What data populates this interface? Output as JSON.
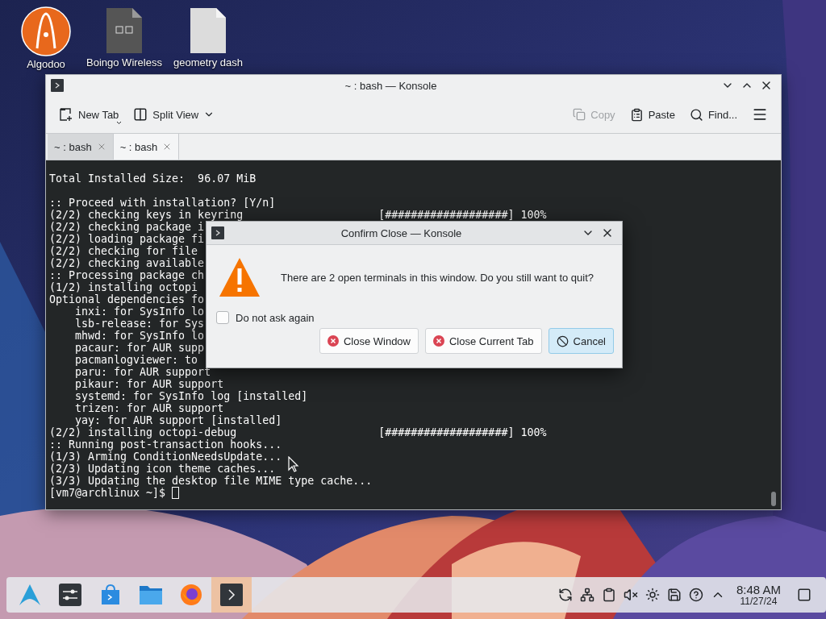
{
  "desktop": {
    "icons": [
      {
        "label": "Algodoo",
        "kind": "app"
      },
      {
        "label": "Boingo Wireless",
        "kind": "dark-file"
      },
      {
        "label": "geometry dash",
        "kind": "file"
      }
    ]
  },
  "window": {
    "title": "~ : bash — Konsole",
    "toolbar": [
      {
        "label": "New Tab",
        "kind": "new-tab",
        "disabled": false
      },
      {
        "label": "Split View",
        "kind": "split",
        "disabled": false
      },
      {
        "label": "Copy",
        "kind": "copy",
        "disabled": true
      },
      {
        "label": "Paste",
        "kind": "paste",
        "disabled": false
      },
      {
        "label": "Find...",
        "kind": "find",
        "disabled": false
      }
    ],
    "tabs": [
      {
        "label": "~ : bash",
        "selected": false
      },
      {
        "label": "~ : bash",
        "selected": true
      }
    ],
    "terminal": {
      "lines": [
        {
          "text": "Total Installed Size:  96.07 MiB",
          "blank_before": true
        },
        {
          "text": ":: Proceed with installation? [Y/n]",
          "blank_before": true
        },
        {
          "text": "(2/2) checking keys in keyring",
          "progress": "[###################] 100%"
        },
        {
          "text": "(2/2) checking package i"
        },
        {
          "text": "(2/2) loading package fi"
        },
        {
          "text": "(2/2) checking for file"
        },
        {
          "text": "(2/2) checking available"
        },
        {
          "text": ":: Processing package ch"
        },
        {
          "text": "(1/2) installing octopi"
        },
        {
          "text": "Optional dependencies fo"
        },
        {
          "text": "    inxi: for SysInfo lo"
        },
        {
          "text": "    lsb-release: for Sys"
        },
        {
          "text": "    mhwd: for SysInfo lo"
        },
        {
          "text": "    pacaur: for AUR supp"
        },
        {
          "text": "    pacmanlogviewer: to"
        },
        {
          "text": "    paru: for AUR support"
        },
        {
          "text": "    pikaur: for AUR support"
        },
        {
          "text": "    systemd: for SysInfo log [installed]"
        },
        {
          "text": "    trizen: for AUR support"
        },
        {
          "text": "    yay: for AUR support [installed]"
        },
        {
          "text": "(2/2) installing octopi-debug",
          "progress": "[###################] 100%"
        },
        {
          "text": ":: Running post-transaction hooks..."
        },
        {
          "text": "(1/3) Arming ConditionNeedsUpdate..."
        },
        {
          "text": "(2/3) Updating icon theme caches..."
        },
        {
          "text": "(3/3) Updating the desktop file MIME type cache..."
        },
        {
          "text": "[vm7@archlinux ~]$ ",
          "cursor": true
        }
      ]
    }
  },
  "dialog": {
    "title": "Confirm Close — Konsole",
    "message": "There are 2 open terminals in this window. Do you still want to quit?",
    "checkbox": {
      "label": "Do not ask again",
      "checked": false
    },
    "buttons": [
      {
        "label": "Close Window",
        "kind": "close",
        "default": false
      },
      {
        "label": "Close Current Tab",
        "kind": "close",
        "default": false
      },
      {
        "label": "Cancel",
        "kind": "cancel",
        "default": true
      }
    ]
  },
  "taskbar": {
    "tasks": [
      {
        "kind": "launcher",
        "selected": false
      },
      {
        "kind": "settings",
        "selected": false
      },
      {
        "kind": "store",
        "selected": false
      },
      {
        "kind": "files",
        "selected": false
      },
      {
        "kind": "browser",
        "selected": false
      },
      {
        "kind": "terminal",
        "selected": true
      }
    ],
    "clock": {
      "time": "8:48 AM",
      "date": "11/27/24"
    }
  }
}
